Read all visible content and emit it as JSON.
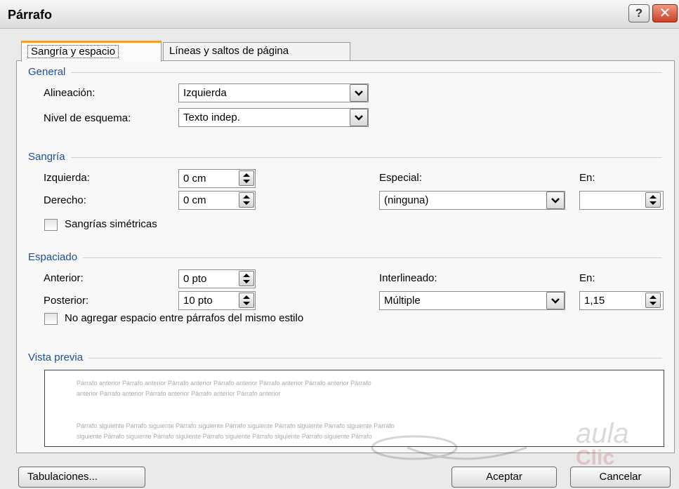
{
  "window": {
    "title": "Párrafo",
    "help_label": "?",
    "close_label": "✕"
  },
  "tabs": [
    {
      "label": "Sangría y espacio",
      "selected": true
    },
    {
      "label": "Líneas y saltos de página",
      "selected": false
    }
  ],
  "general": {
    "heading": "General",
    "alignment_label": "Alineación:",
    "alignment_value": "Izquierda",
    "outline_label": "Nivel de esquema:",
    "outline_value": "Texto indep."
  },
  "indent": {
    "heading": "Sangría",
    "left_label": "Izquierda:",
    "left_value": "0 cm",
    "right_label": "Derecho:",
    "right_value": "0 cm",
    "special_label": "Especial:",
    "special_value": "(ninguna)",
    "by_label": "En:",
    "by_value": "",
    "mirror_label": "Sangrías simétricas",
    "mirror_checked": false
  },
  "spacing": {
    "heading": "Espaciado",
    "before_label": "Anterior:",
    "before_value": "0 pto",
    "after_label": "Posterior:",
    "after_value": "10 pto",
    "line_label": "Interlineado:",
    "line_value": "Múltiple",
    "at_label": "En:",
    "at_value": "1,15",
    "dont_add_label": "No agregar espacio entre párrafos del mismo estilo",
    "dont_add_checked": false
  },
  "preview": {
    "heading": "Vista previa",
    "prev_line1": "Párrafo anterior Párrafo anterior Párrafo anterior Párrafo anterior Párrafo anterior Párrafo anterior Párrafo",
    "prev_line2": "anterior Párrafo anterior Párrafo anterior Párrafo anterior Párrafo anterior",
    "next_line1": "Párrafo siguiente Párrafo siguiente Párrafo siguiente Párrafo siguiente Párrafo siguiente Párrafo siguiente Párrafo",
    "next_line2": "siguiente Párrafo siguiente Párrafo siguiente Párrafo siguiente Párrafo siguiente Párrafo siguiente Párrafo"
  },
  "watermark": {
    "text": "aula",
    "subtext": "Clic"
  },
  "buttons": {
    "tabs_label": "Tabulaciones...",
    "ok_label": "Aceptar",
    "cancel_label": "Cancelar"
  },
  "colors": {
    "section_heading": "#1f4e9a",
    "close_button": "#c94025",
    "active_tab_accent": "#f0a030"
  }
}
